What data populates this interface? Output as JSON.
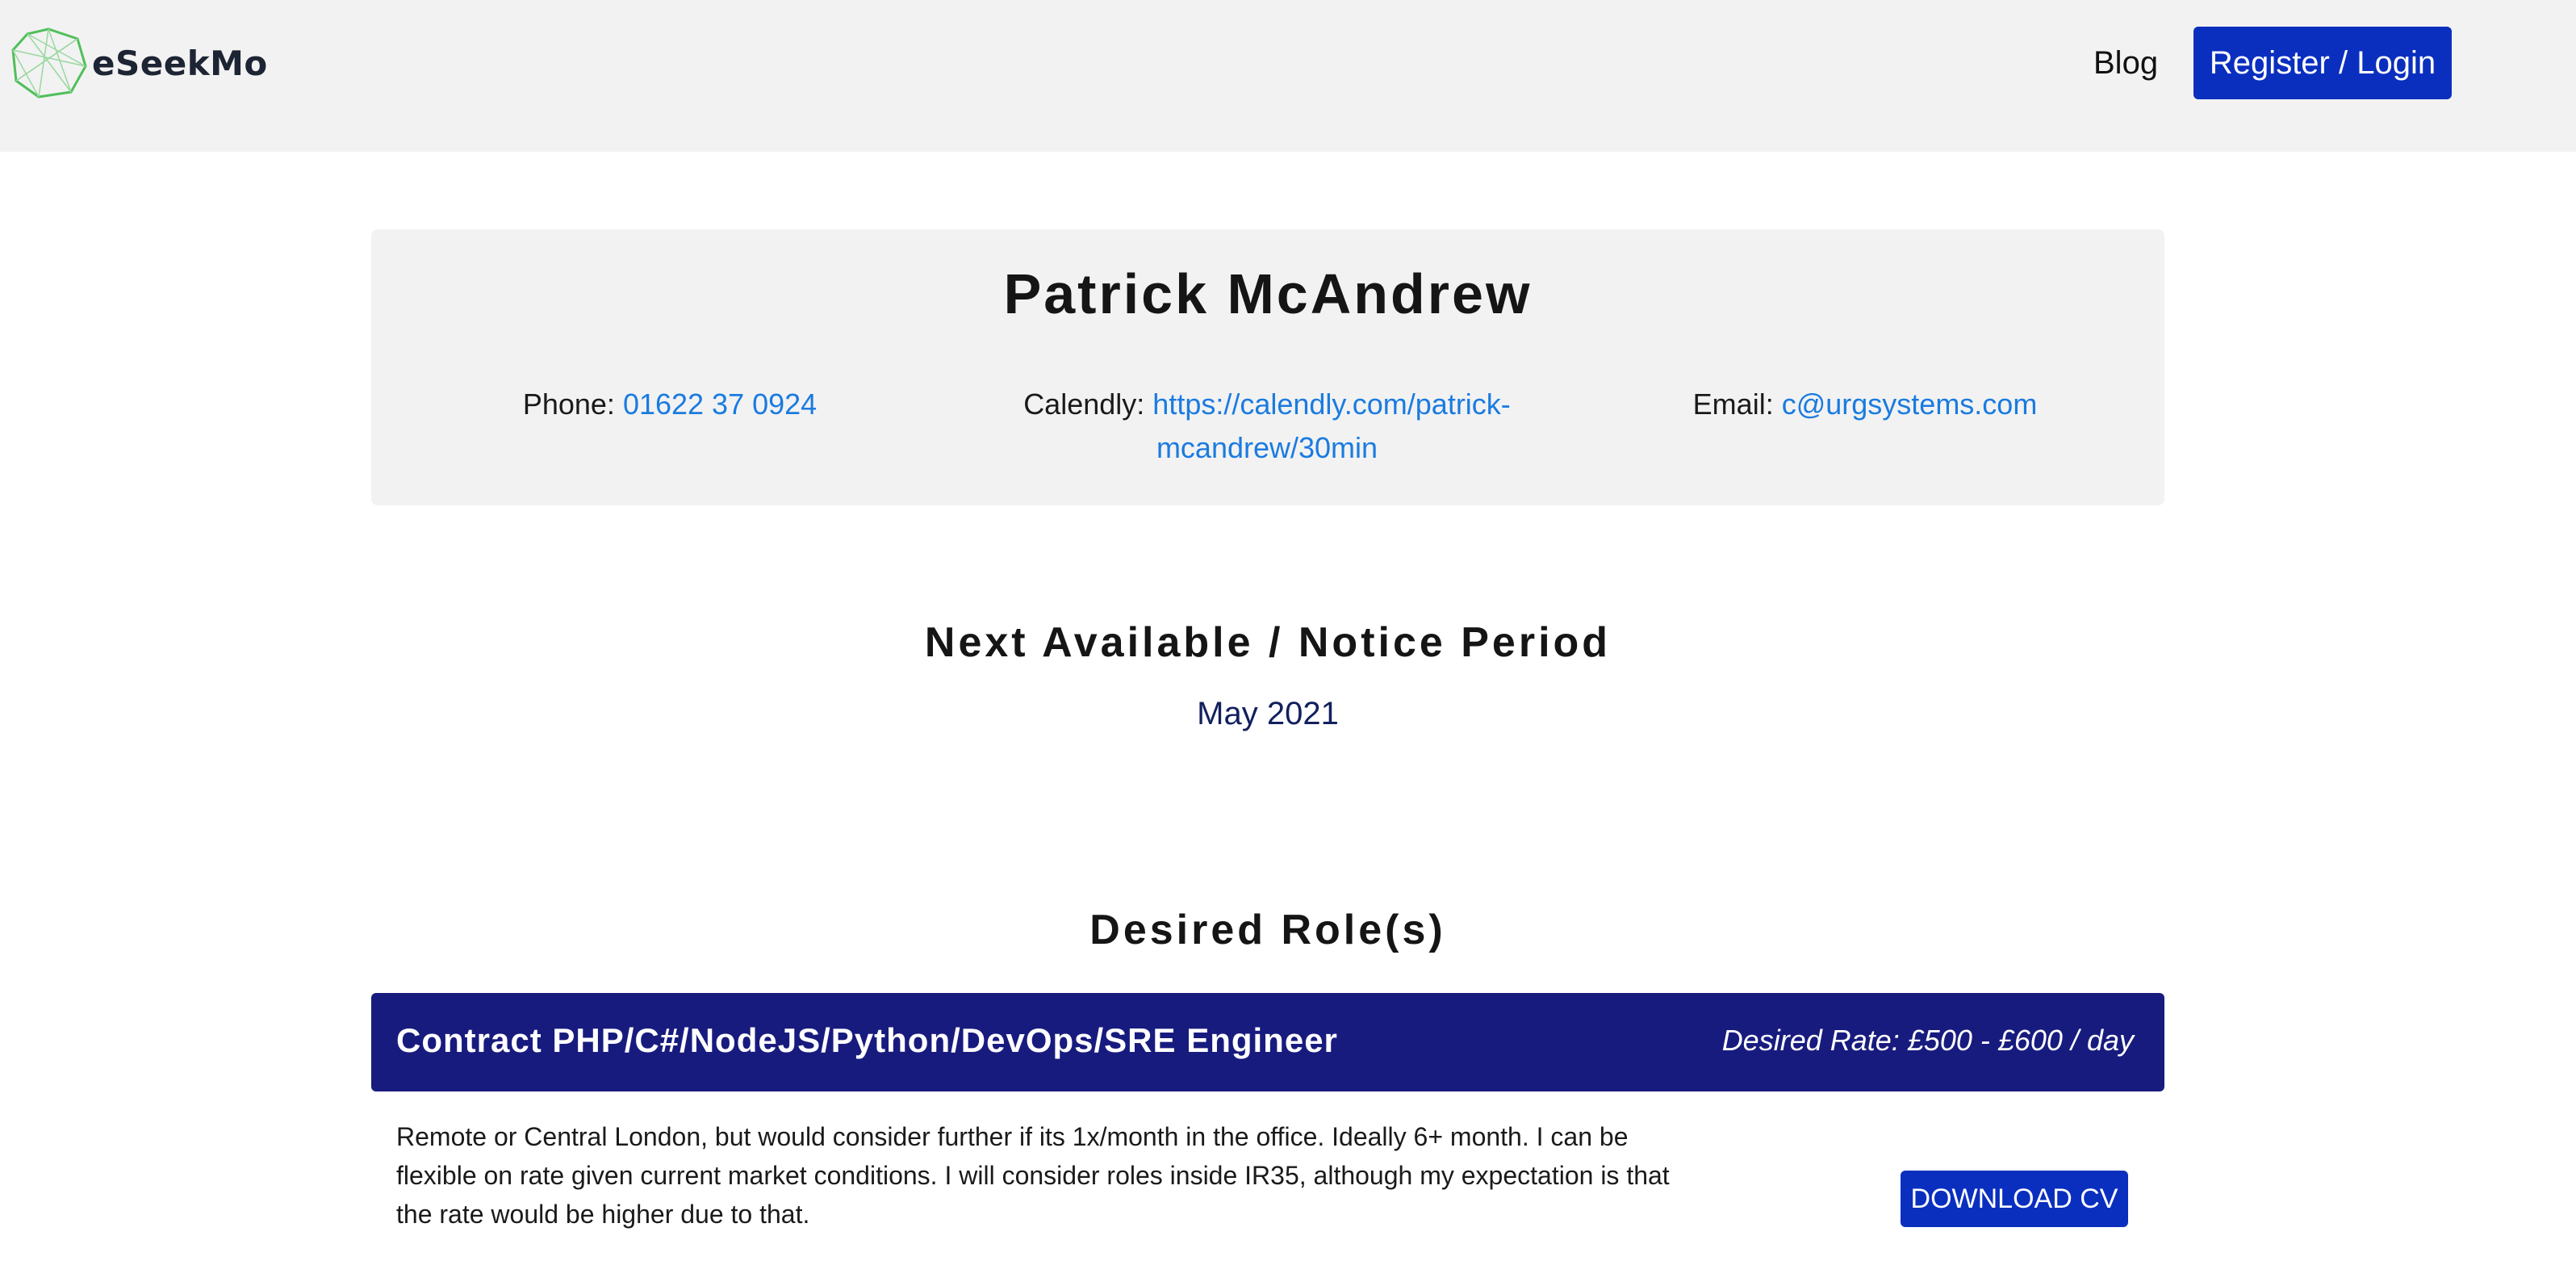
{
  "header": {
    "logo_text": "eSeekMo",
    "blog_label": "Blog",
    "login_label": "Register / Login"
  },
  "profile": {
    "name": "Patrick McAndrew",
    "phone_label": "Phone:",
    "phone_value": "01622 37 0924",
    "calendly_label": "Calendly:",
    "calendly_value": "https://calendly.com/patrick-mcandrew/30min",
    "email_label": "Email:",
    "email_value": "c@urgsystems.com"
  },
  "availability": {
    "title": "Next Available / Notice Period",
    "value": "May 2021"
  },
  "roles": {
    "title": "Desired Role(s)",
    "items": [
      {
        "title": "Contract PHP/C#/NodeJS/Python/DevOps/SRE Engineer",
        "rate": "Desired Rate: £500 - £600 / day",
        "description": "Remote or Central London, but would consider further if its 1x/month in the office. Ideally 6+ month. I can be flexible on rate given current market conditions. I will consider roles inside IR35, although my expectation is that the rate would be higher due to that.",
        "download_label": "DOWNLOAD CV"
      }
    ]
  },
  "colors": {
    "primary_button": "#0a2fbf",
    "role_bar": "#181b7e",
    "link": "#1a7be0",
    "logo_green": "#4fbf5a"
  }
}
